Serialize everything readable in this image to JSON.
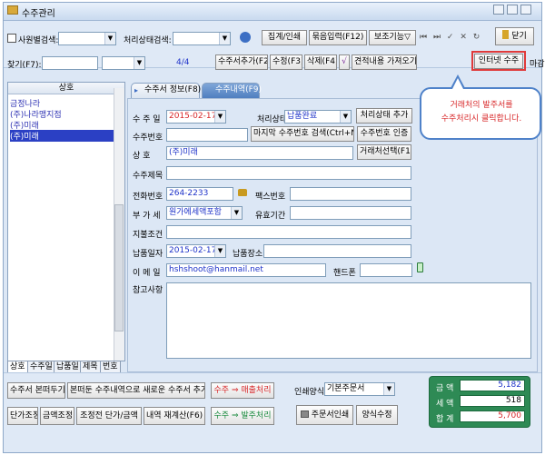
{
  "window": {
    "title": "수주관리"
  },
  "toolbar": {
    "staff_search_label": "사원별검색:",
    "status_search_label": "처리상태검색:",
    "btn_aggregate_print": "집계/인쇄",
    "btn_bundle_input": "묶음입력(F12)",
    "btn_aux": "보조기능▽",
    "nav_glyphs": "⏮ ⏭ ✓ ✕ ↻",
    "btn_close": "닫기",
    "find_label": "찾기(F7):",
    "page_counter": "4/4",
    "btn_add_order": "수주서추가(F2)",
    "btn_edit": "수정(F3)",
    "btn_delete": "삭제(F4)",
    "btn_import_quote": "견적내용 가져오기",
    "btn_internet_order": "인터넷 수주",
    "close_label": "마감"
  },
  "list": {
    "header": "상호",
    "items": [
      "금정나라",
      "(주)나라맹지점",
      "(주)미래",
      "(주)미래"
    ],
    "tabs": [
      "상호",
      "수주일",
      "납품일",
      "제목",
      "번호"
    ]
  },
  "tabs": {
    "order_info": "수주서 정보(F8)",
    "order_detail": "수주내역(F9)"
  },
  "form": {
    "order_date_label": "수 주 일",
    "order_date": "2015-02-17",
    "status_label": "처리상태",
    "status_value": "납품완료",
    "btn_add_status": "처리상태 추가",
    "order_no_label": "수주번호",
    "btn_last_order_no": "마지막 수주번호 검색(Ctrl+N)",
    "btn_verify_order_no": "수주번호 인증",
    "company_label": "상    호",
    "company_value": "(주)미래",
    "btn_select_client": "거래처선택(F11)",
    "subject_label": "수주제목",
    "phone_label": "전화번호",
    "phone_value": "264-2233",
    "fax_label": "팩스번호",
    "vat_label": "부 가 세",
    "vat_value": "원가에세액포함",
    "validity_label": "유효기간",
    "payment_label": "지불조건",
    "delivery_date_label": "납품일자",
    "delivery_date": "2015-02-17",
    "delivery_place_label": "납품장소",
    "email_label": "이 메 일",
    "email_value": "hshshoot@hanmail.net",
    "mobile_label": "핸드폰",
    "memo_label": "참고사항"
  },
  "callout": {
    "line1": "거래처의 발주서를",
    "line2": "수주처리시 클릭합니다."
  },
  "bottom": {
    "btn_copy_order": "수주서 본떠두기",
    "btn_new_from_copy": "본떠둔 수주내역으로 새로운 수주서 추가",
    "btn_to_sales_a": "수주",
    "btn_to_sales_b": "매출처리",
    "btn_unit_adjust": "단가조정",
    "btn_amount_adjust": "금액조정",
    "btn_adjusted_price": "조정전 단가/금액",
    "btn_recalc": "내역 재계산(F6)",
    "btn_to_purchase_a": "수주",
    "btn_to_purchase_b": "발주처리",
    "print_format_label": "인쇄양식",
    "print_format_value": "기본주문서",
    "btn_print_order": "주문서인쇄",
    "btn_edit_format": "양식수정",
    "arrow": "⇒"
  },
  "totals": {
    "amount_label": "금 액",
    "amount": "5,182",
    "tax_label": "세 액",
    "tax": "518",
    "total_label": "합 계",
    "total": "5,700"
  },
  "colors": {
    "accent_blue": "#1f33c9",
    "accent_red": "#d8282a",
    "total_green": "#2e8a55",
    "callout_border": "#4f82c9"
  }
}
